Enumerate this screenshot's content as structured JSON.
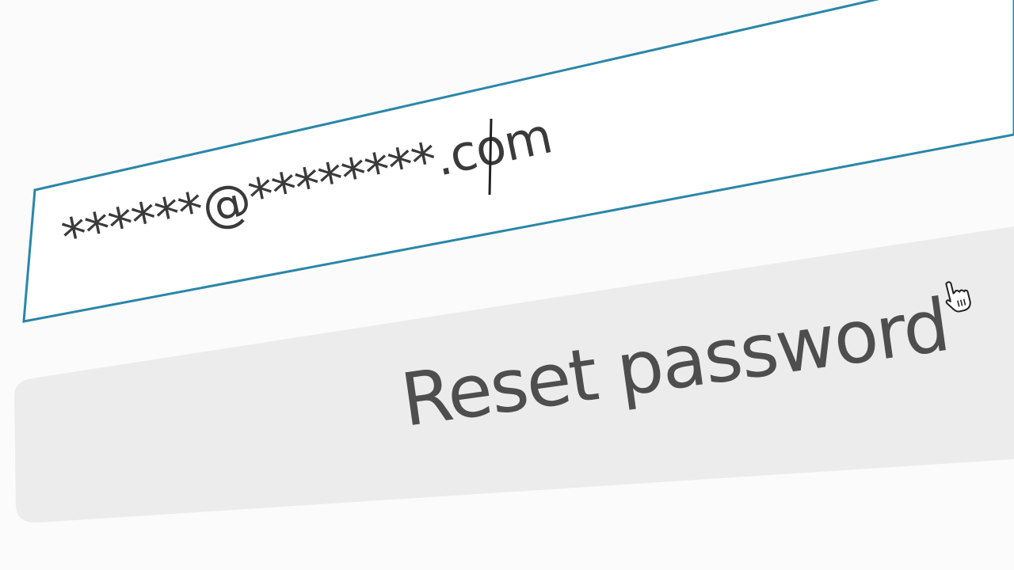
{
  "form": {
    "email_field": {
      "value": "******@********.com",
      "border_color": "#2a86a8",
      "text_color": "#3a3a3a"
    },
    "reset_button": {
      "label": "Reset password",
      "background": "#ececec",
      "text_color": "#4e4e4e"
    },
    "cursor": {
      "icon": "hand-pointer-icon"
    }
  }
}
